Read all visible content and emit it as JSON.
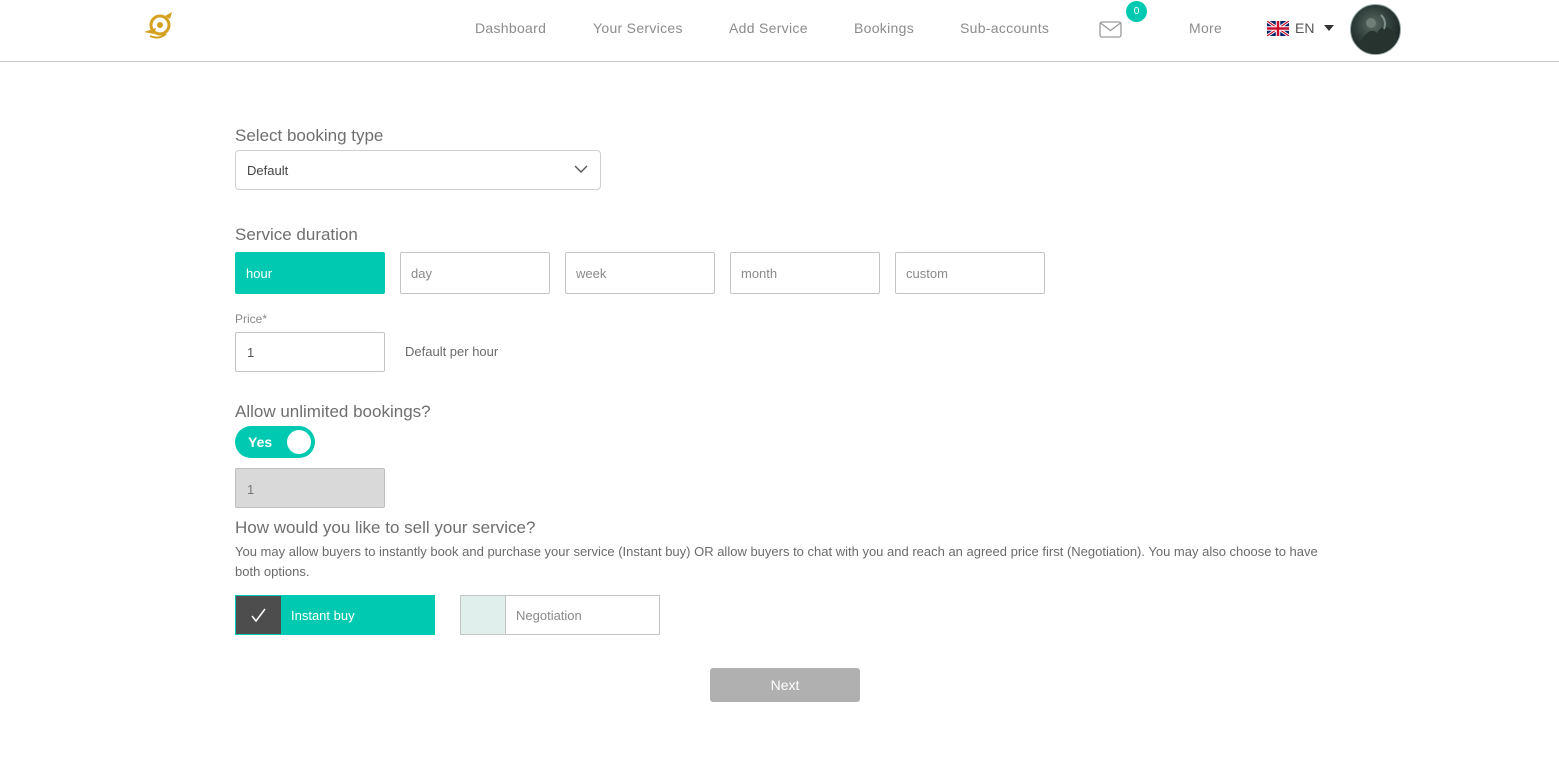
{
  "header": {
    "nav": [
      {
        "label": "Dashboard"
      },
      {
        "label": "Your Services"
      },
      {
        "label": "Add Service"
      },
      {
        "label": "Bookings"
      },
      {
        "label": "Sub-accounts"
      }
    ],
    "messages_count": "0",
    "more_label": "More",
    "language": "EN",
    "colors": {
      "accent": "#00c9b1"
    }
  },
  "form": {
    "booking_type": {
      "title": "Select booking type",
      "selected": "Default"
    },
    "duration": {
      "title": "Service duration",
      "options": [
        "hour",
        "day",
        "week",
        "month",
        "custom"
      ],
      "selected": "hour"
    },
    "price": {
      "label": "Price*",
      "value": "1",
      "note": "Default per hour"
    },
    "unlimited": {
      "title": "Allow unlimited bookings?",
      "toggle_label": "Yes",
      "toggle_on": true,
      "limit_value": "1"
    },
    "sell": {
      "title": "How would you like to sell your service?",
      "description": "You may allow buyers to instantly book and purchase your service (Instant buy) OR allow buyers to chat with you and reach an agreed price first (Negotiation). You may also choose to have both options.",
      "options": [
        {
          "label": "Instant buy",
          "checked": true
        },
        {
          "label": "Negotiation",
          "checked": false
        }
      ]
    },
    "next_label": "Next"
  }
}
